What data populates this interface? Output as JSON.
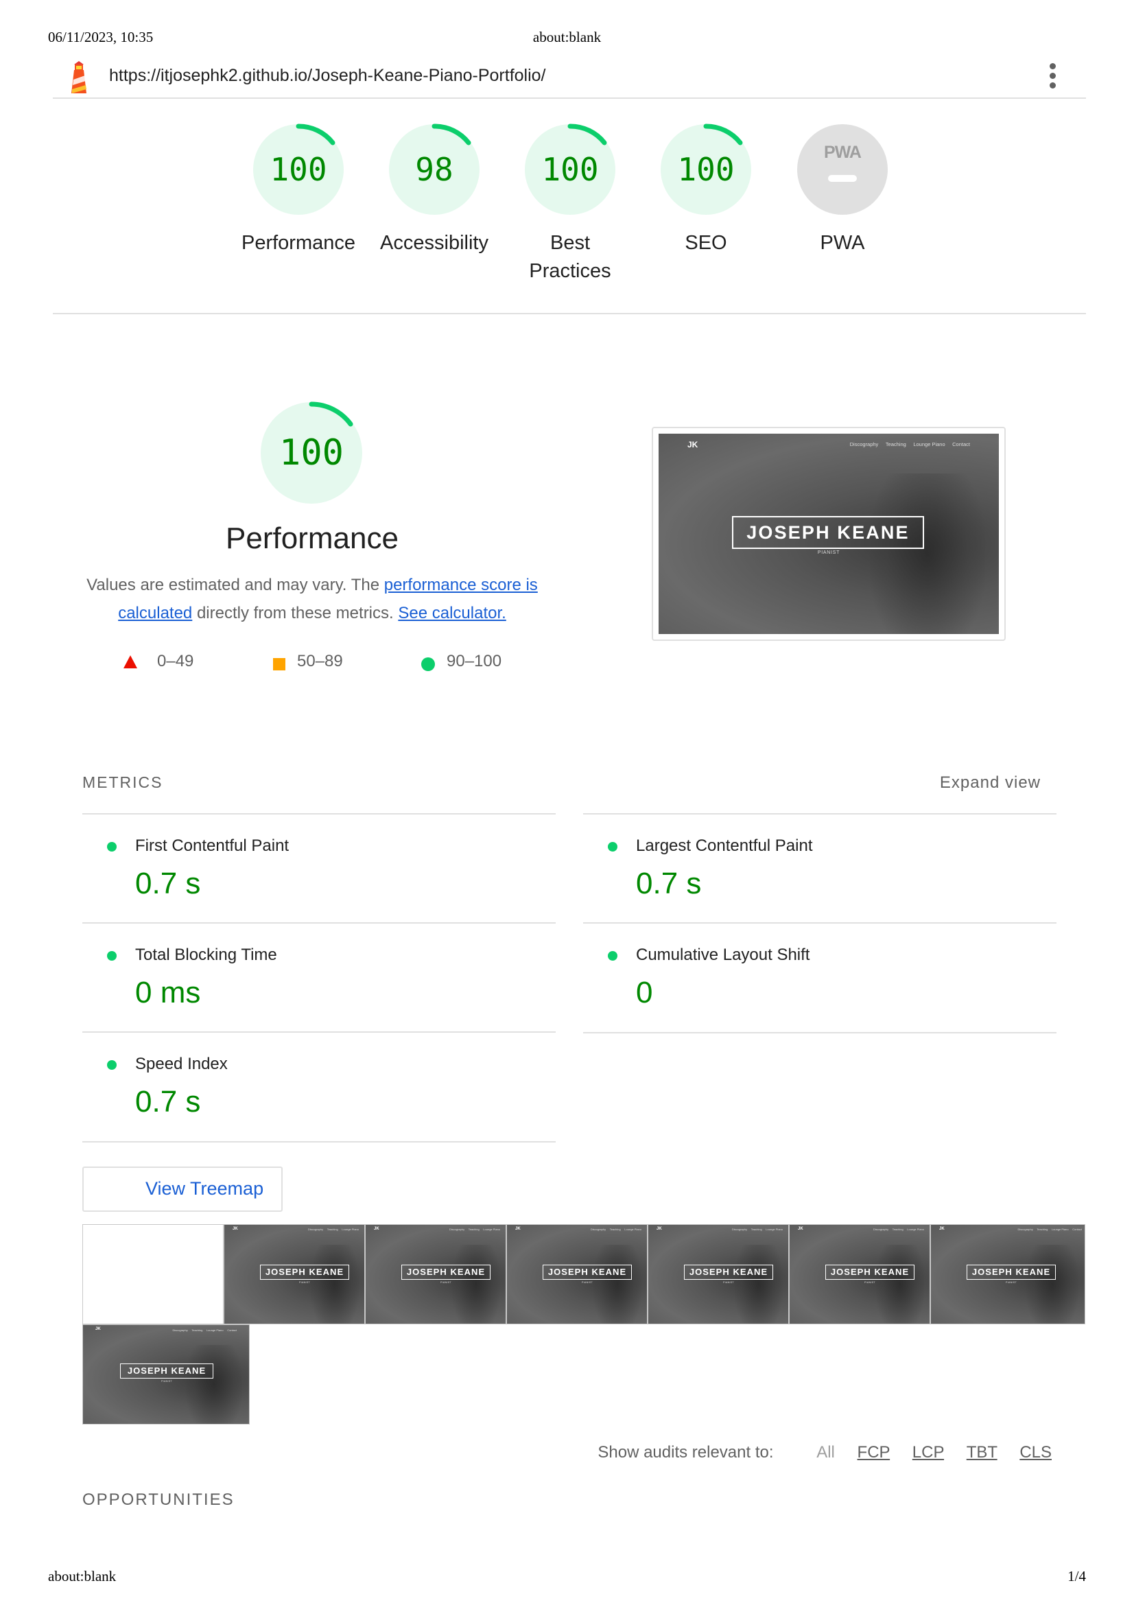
{
  "print_header": {
    "date": "06/11/2023, 10:35",
    "title": "about:blank"
  },
  "print_footer": {
    "left": "about:blank",
    "page": "1/4"
  },
  "report": {
    "url": "https://itjosephk2.github.io/Joseph-Keane-Piano-Portfolio/",
    "logo_icon": "lighthouse-icon",
    "menu_icon": "kebab-menu-icon"
  },
  "gauges": [
    {
      "score": "100",
      "label": "Performance",
      "status": "pass"
    },
    {
      "score": "98",
      "label": "Accessibility",
      "status": "pass"
    },
    {
      "score": "100",
      "label": "Best Practices",
      "status": "pass"
    },
    {
      "score": "100",
      "label": "SEO",
      "status": "pass"
    },
    {
      "score": "",
      "label": "PWA",
      "status": "na",
      "badge": "PWA"
    }
  ],
  "performance": {
    "score": "100",
    "title": "Performance",
    "desc_before": "Values are estimated and may vary. The ",
    "desc_link1": "performance score is calculated",
    "desc_middle": " directly from these metrics. ",
    "desc_link2": "See calculator.",
    "legend": [
      {
        "range": "0–49",
        "shape": "triangle",
        "color": "#eb0f00"
      },
      {
        "range": "50–89",
        "shape": "square",
        "color": "#ffa400"
      },
      {
        "range": "90–100",
        "shape": "circle",
        "color": "#0cce6b"
      }
    ]
  },
  "site_preview": {
    "logo": "JK",
    "nav": [
      "Discography",
      "Teaching",
      "Lounge Piano",
      "Contact"
    ],
    "name": "JOSEPH KEANE",
    "subtitle": "PIANIST"
  },
  "metrics": {
    "heading": "METRICS",
    "expand_label": "Expand view",
    "items": [
      {
        "label": "First Contentful Paint",
        "value": "0.7 s"
      },
      {
        "label": "Largest Contentful Paint",
        "value": "0.7 s"
      },
      {
        "label": "Total Blocking Time",
        "value": "0 ms"
      },
      {
        "label": "Cumulative Layout Shift",
        "value": "0"
      },
      {
        "label": "Speed Index",
        "value": "0.7 s"
      }
    ]
  },
  "treemap_button": {
    "label": "View Treemap",
    "icon": "treemap-icon"
  },
  "filmstrip": {
    "frame_count": 8,
    "blank_frames": 1
  },
  "audit_filter": {
    "label": "Show audits relevant to:",
    "options": [
      "All",
      "FCP",
      "LCP",
      "TBT",
      "CLS"
    ],
    "active": "All"
  },
  "opportunities_heading": "OPPORTUNITIES",
  "colors": {
    "pass": "#0cce6b",
    "pass_text": "#008800",
    "link": "#1a5fd4",
    "na_gray": "#e0e0e0"
  }
}
